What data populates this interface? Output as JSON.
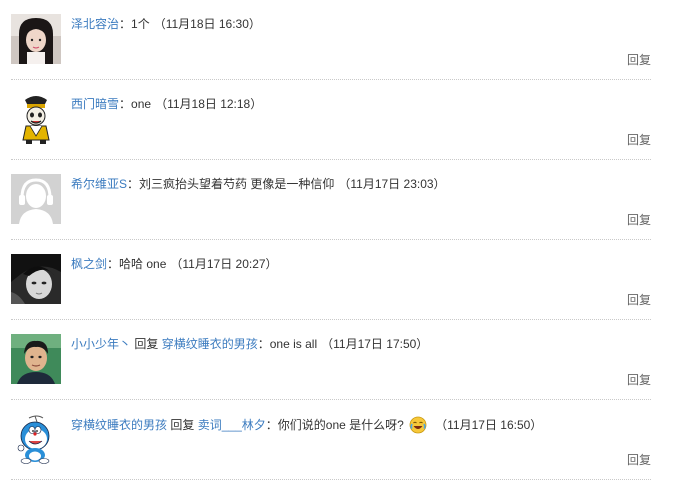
{
  "reply_label": "回复",
  "comments": [
    {
      "user": "泽北容治",
      "text": "1个",
      "time": "（11月18日 16:30）",
      "avatar_icon": "girl-photo-avatar"
    },
    {
      "user": "西门暗雪",
      "text": "one",
      "time": "（11月18日 12:18）",
      "avatar_icon": "cartoon-figure-avatar"
    },
    {
      "user": "希尔维亚S",
      "text": "刘三疯抬头望着芍药 更像是一种信仰",
      "time": "（11月17日 23:03）",
      "avatar_icon": "default-headphone-avatar"
    },
    {
      "user": "枫之剑",
      "text": "哈哈 one",
      "time": "（11月17日 20:27）",
      "avatar_icon": "bw-photo-avatar"
    },
    {
      "user": "小小少年丶",
      "reply_word": "回复",
      "reply_to": "穿横纹睡衣的男孩",
      "text": "one is all",
      "time": "（11月17日 17:50）",
      "avatar_icon": "boy-photo-avatar"
    },
    {
      "user": "穿横纹睡衣的男孩",
      "reply_word": "回复",
      "reply_to": "卖词___林夕",
      "text": "你们说的one 是什么呀?",
      "emoji": "laugh-cry-emoji",
      "time": "（11月17日 16:50）",
      "avatar_icon": "doraemon-avatar"
    }
  ]
}
